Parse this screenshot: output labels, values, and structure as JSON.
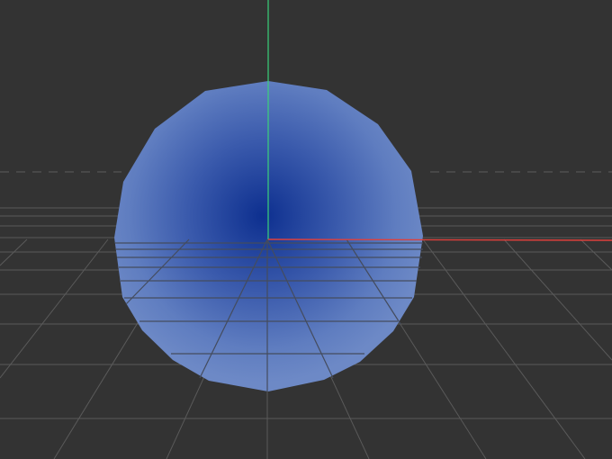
{
  "viewport": {
    "background": "#333333",
    "grid_color": "#5a5a5a",
    "horizon_dash_color": "#5c5c5c",
    "show_grid": true
  },
  "axes": {
    "x_axis_color": "#e0403c",
    "y_axis_color": "#3ad17a"
  },
  "object": {
    "type": "sphere",
    "shading": "flat low-poly",
    "center_color": "#0d2f8f",
    "edge_color": "#6d89c6"
  }
}
